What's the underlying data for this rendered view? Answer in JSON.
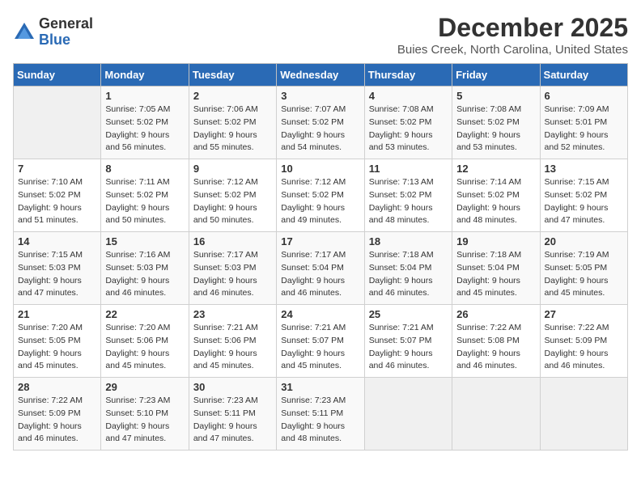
{
  "logo": {
    "general": "General",
    "blue": "Blue"
  },
  "title": "December 2025",
  "location": "Buies Creek, North Carolina, United States",
  "days_of_week": [
    "Sunday",
    "Monday",
    "Tuesday",
    "Wednesday",
    "Thursday",
    "Friday",
    "Saturday"
  ],
  "weeks": [
    [
      {
        "day": "",
        "info": ""
      },
      {
        "day": "1",
        "info": "Sunrise: 7:05 AM\nSunset: 5:02 PM\nDaylight: 9 hours\nand 56 minutes."
      },
      {
        "day": "2",
        "info": "Sunrise: 7:06 AM\nSunset: 5:02 PM\nDaylight: 9 hours\nand 55 minutes."
      },
      {
        "day": "3",
        "info": "Sunrise: 7:07 AM\nSunset: 5:02 PM\nDaylight: 9 hours\nand 54 minutes."
      },
      {
        "day": "4",
        "info": "Sunrise: 7:08 AM\nSunset: 5:02 PM\nDaylight: 9 hours\nand 53 minutes."
      },
      {
        "day": "5",
        "info": "Sunrise: 7:08 AM\nSunset: 5:02 PM\nDaylight: 9 hours\nand 53 minutes."
      },
      {
        "day": "6",
        "info": "Sunrise: 7:09 AM\nSunset: 5:01 PM\nDaylight: 9 hours\nand 52 minutes."
      }
    ],
    [
      {
        "day": "7",
        "info": "Sunrise: 7:10 AM\nSunset: 5:02 PM\nDaylight: 9 hours\nand 51 minutes."
      },
      {
        "day": "8",
        "info": "Sunrise: 7:11 AM\nSunset: 5:02 PM\nDaylight: 9 hours\nand 50 minutes."
      },
      {
        "day": "9",
        "info": "Sunrise: 7:12 AM\nSunset: 5:02 PM\nDaylight: 9 hours\nand 50 minutes."
      },
      {
        "day": "10",
        "info": "Sunrise: 7:12 AM\nSunset: 5:02 PM\nDaylight: 9 hours\nand 49 minutes."
      },
      {
        "day": "11",
        "info": "Sunrise: 7:13 AM\nSunset: 5:02 PM\nDaylight: 9 hours\nand 48 minutes."
      },
      {
        "day": "12",
        "info": "Sunrise: 7:14 AM\nSunset: 5:02 PM\nDaylight: 9 hours\nand 48 minutes."
      },
      {
        "day": "13",
        "info": "Sunrise: 7:15 AM\nSunset: 5:02 PM\nDaylight: 9 hours\nand 47 minutes."
      }
    ],
    [
      {
        "day": "14",
        "info": "Sunrise: 7:15 AM\nSunset: 5:03 PM\nDaylight: 9 hours\nand 47 minutes."
      },
      {
        "day": "15",
        "info": "Sunrise: 7:16 AM\nSunset: 5:03 PM\nDaylight: 9 hours\nand 46 minutes."
      },
      {
        "day": "16",
        "info": "Sunrise: 7:17 AM\nSunset: 5:03 PM\nDaylight: 9 hours\nand 46 minutes."
      },
      {
        "day": "17",
        "info": "Sunrise: 7:17 AM\nSunset: 5:04 PM\nDaylight: 9 hours\nand 46 minutes."
      },
      {
        "day": "18",
        "info": "Sunrise: 7:18 AM\nSunset: 5:04 PM\nDaylight: 9 hours\nand 46 minutes."
      },
      {
        "day": "19",
        "info": "Sunrise: 7:18 AM\nSunset: 5:04 PM\nDaylight: 9 hours\nand 45 minutes."
      },
      {
        "day": "20",
        "info": "Sunrise: 7:19 AM\nSunset: 5:05 PM\nDaylight: 9 hours\nand 45 minutes."
      }
    ],
    [
      {
        "day": "21",
        "info": "Sunrise: 7:20 AM\nSunset: 5:05 PM\nDaylight: 9 hours\nand 45 minutes."
      },
      {
        "day": "22",
        "info": "Sunrise: 7:20 AM\nSunset: 5:06 PM\nDaylight: 9 hours\nand 45 minutes."
      },
      {
        "day": "23",
        "info": "Sunrise: 7:21 AM\nSunset: 5:06 PM\nDaylight: 9 hours\nand 45 minutes."
      },
      {
        "day": "24",
        "info": "Sunrise: 7:21 AM\nSunset: 5:07 PM\nDaylight: 9 hours\nand 45 minutes."
      },
      {
        "day": "25",
        "info": "Sunrise: 7:21 AM\nSunset: 5:07 PM\nDaylight: 9 hours\nand 46 minutes."
      },
      {
        "day": "26",
        "info": "Sunrise: 7:22 AM\nSunset: 5:08 PM\nDaylight: 9 hours\nand 46 minutes."
      },
      {
        "day": "27",
        "info": "Sunrise: 7:22 AM\nSunset: 5:09 PM\nDaylight: 9 hours\nand 46 minutes."
      }
    ],
    [
      {
        "day": "28",
        "info": "Sunrise: 7:22 AM\nSunset: 5:09 PM\nDaylight: 9 hours\nand 46 minutes."
      },
      {
        "day": "29",
        "info": "Sunrise: 7:23 AM\nSunset: 5:10 PM\nDaylight: 9 hours\nand 47 minutes."
      },
      {
        "day": "30",
        "info": "Sunrise: 7:23 AM\nSunset: 5:11 PM\nDaylight: 9 hours\nand 47 minutes."
      },
      {
        "day": "31",
        "info": "Sunrise: 7:23 AM\nSunset: 5:11 PM\nDaylight: 9 hours\nand 48 minutes."
      },
      {
        "day": "",
        "info": ""
      },
      {
        "day": "",
        "info": ""
      },
      {
        "day": "",
        "info": ""
      }
    ]
  ]
}
